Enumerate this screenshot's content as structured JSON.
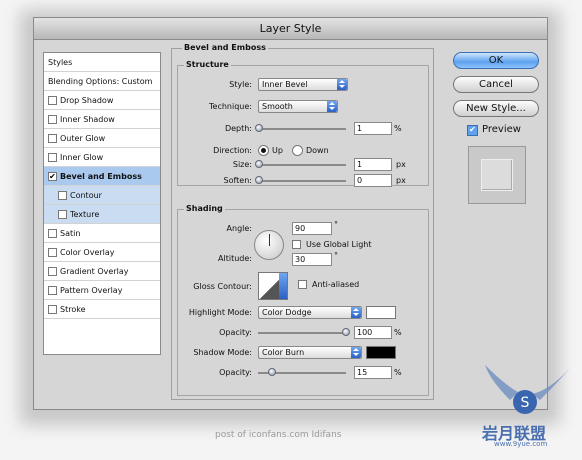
{
  "window": {
    "title": "Layer Style"
  },
  "sidebar": {
    "items": [
      {
        "label": "Styles",
        "checkbox": false,
        "checked": false
      },
      {
        "label": "Blending Options: Custom",
        "checkbox": false,
        "checked": false
      },
      {
        "label": "Drop Shadow",
        "checkbox": true,
        "checked": false
      },
      {
        "label": "Inner Shadow",
        "checkbox": true,
        "checked": false
      },
      {
        "label": "Outer Glow",
        "checkbox": true,
        "checked": false
      },
      {
        "label": "Inner Glow",
        "checkbox": true,
        "checked": false
      },
      {
        "label": "Bevel and Emboss",
        "checkbox": true,
        "checked": true
      },
      {
        "label": "Contour",
        "checkbox": true,
        "checked": false
      },
      {
        "label": "Texture",
        "checkbox": true,
        "checked": false
      },
      {
        "label": "Satin",
        "checkbox": true,
        "checked": false
      },
      {
        "label": "Color Overlay",
        "checkbox": true,
        "checked": false
      },
      {
        "label": "Gradient Overlay",
        "checkbox": true,
        "checked": false
      },
      {
        "label": "Pattern Overlay",
        "checkbox": true,
        "checked": false
      },
      {
        "label": "Stroke",
        "checkbox": true,
        "checked": false
      }
    ]
  },
  "panel": {
    "title": "Bevel and Emboss",
    "structure": {
      "title": "Structure",
      "style_label": "Style:",
      "style_value": "Inner Bevel",
      "technique_label": "Technique:",
      "technique_value": "Smooth",
      "depth_label": "Depth:",
      "depth_value": "1",
      "depth_unit": "%",
      "direction_label": "Direction:",
      "dir_up": "Up",
      "dir_down": "Down",
      "size_label": "Size:",
      "size_value": "1",
      "size_unit": "px",
      "soften_label": "Soften:",
      "soften_value": "0",
      "soften_unit": "px"
    },
    "shading": {
      "title": "Shading",
      "angle_label": "Angle:",
      "angle_value": "90",
      "angle_unit": "°",
      "global_light": "Use Global Light",
      "altitude_label": "Altitude:",
      "altitude_value": "30",
      "altitude_unit": "°",
      "gloss_label": "Gloss Contour:",
      "anti_aliased": "Anti-aliased",
      "highlight_label": "Highlight Mode:",
      "highlight_value": "Color Dodge",
      "highlight_color": "#ffffff",
      "h_opacity_label": "Opacity:",
      "h_opacity_value": "100",
      "h_opacity_unit": "%",
      "shadow_label": "Shadow Mode:",
      "shadow_value": "Color Burn",
      "shadow_color": "#000000",
      "s_opacity_label": "Opacity:",
      "s_opacity_value": "15",
      "s_opacity_unit": "%"
    }
  },
  "buttons": {
    "ok": "OK",
    "cancel": "Cancel",
    "new_style": "New Style...",
    "preview": "Preview"
  },
  "footer": {
    "text": "post of iconfans.com  Idifans"
  },
  "watermark": {
    "text": "岩月联盟",
    "url": "www.9yue.com"
  }
}
